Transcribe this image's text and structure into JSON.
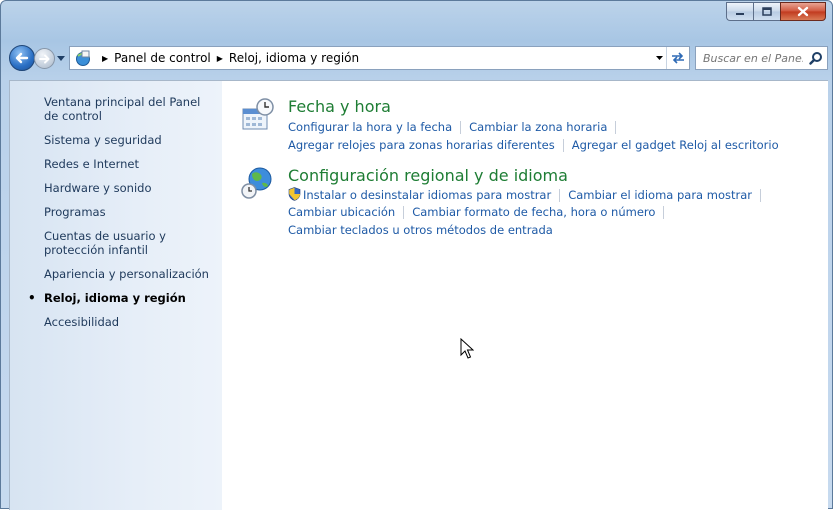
{
  "window": {
    "caption_buttons": {
      "minimize": "minimize-icon",
      "maximize": "maximize-icon",
      "close": "close-icon"
    }
  },
  "navigation": {
    "breadcrumb": [
      "Panel de control",
      "Reloj, idioma y región"
    ],
    "search_placeholder": "Buscar en el Pane..."
  },
  "sidebar": {
    "items": [
      {
        "label": "Ventana principal del Panel de control",
        "current": false
      },
      {
        "label": "Sistema y seguridad",
        "current": false
      },
      {
        "label": "Redes e Internet",
        "current": false
      },
      {
        "label": "Hardware y sonido",
        "current": false
      },
      {
        "label": "Programas",
        "current": false
      },
      {
        "label": "Cuentas de usuario y protección infantil",
        "current": false
      },
      {
        "label": "Apariencia y personalización",
        "current": false
      },
      {
        "label": "Reloj, idioma y región",
        "current": true
      },
      {
        "label": "Accesibilidad",
        "current": false
      }
    ]
  },
  "main": {
    "categories": [
      {
        "title": "Fecha y hora",
        "links": [
          "Configurar la hora y la fecha",
          "Cambiar la zona horaria",
          "Agregar relojes para zonas horarias diferentes",
          "Agregar el gadget Reloj al escritorio"
        ]
      },
      {
        "title": "Configuración regional y de idioma",
        "links": [
          "Instalar o desinstalar idiomas para mostrar",
          "Cambiar el idioma para mostrar",
          "Cambiar ubicación",
          "Cambiar formato de fecha, hora o número",
          "Cambiar teclados u otros métodos de entrada"
        ]
      }
    ]
  },
  "colors": {
    "category_title": "#1e7d34",
    "link": "#1e5aa6",
    "sidebar_link": "#1e395b"
  }
}
